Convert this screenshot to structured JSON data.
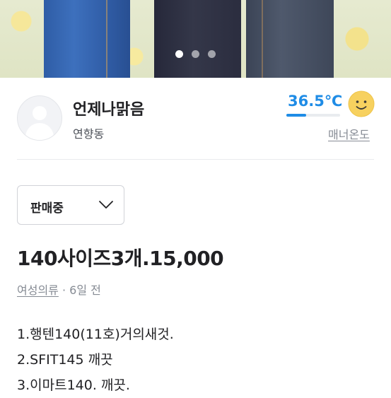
{
  "carousel": {
    "page_count": 3,
    "active_index": 0
  },
  "seller": {
    "name": "언제나맑음",
    "location": "연향동",
    "manner_temp": "36.5℃",
    "manner_temp_value": 36.5,
    "manner_label": "매너온도",
    "temp_color": "#1f8ce6"
  },
  "status_select": {
    "value": "판매중"
  },
  "product": {
    "title": "140사이즈3개.15,000",
    "category": "여성의류",
    "separator": " · ",
    "time": "6일 전",
    "description": [
      "1.행텐140(11호)거의새것.",
      "2.SFIT145 깨끗",
      "3.이마트140. 깨끗."
    ]
  },
  "icons": {
    "avatar": "default-profile-icon",
    "face": "smile-face-icon",
    "chevron": "chevron-down-icon"
  }
}
